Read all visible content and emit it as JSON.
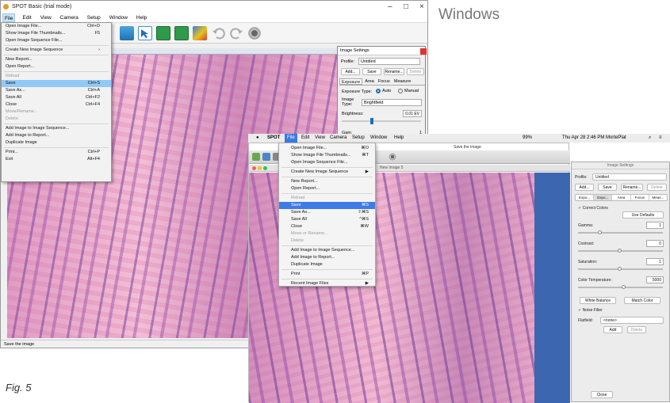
{
  "header": {
    "platform_label": "Windows",
    "figure_caption": "Fig. 5"
  },
  "windows_app": {
    "title": "SPOT Basic (trial mode)",
    "controls": [
      "–",
      "□",
      "×"
    ],
    "menubar": [
      "File",
      "Edit",
      "View",
      "Camera",
      "Setup",
      "Window",
      "Help"
    ],
    "file_menu": [
      {
        "label": "Open Image File...",
        "shortcut": "Ctrl+O"
      },
      {
        "label": "Show Image File Thumbnails...",
        "shortcut": "F5"
      },
      {
        "label": "Open Image Sequence File...",
        "shortcut": ""
      },
      {
        "sep": true
      },
      {
        "label": "Create New Image Sequence",
        "shortcut": "›"
      },
      {
        "sep": true
      },
      {
        "label": "New Report...",
        "shortcut": ""
      },
      {
        "label": "Open Report...",
        "shortcut": ""
      },
      {
        "sep": true
      },
      {
        "label": "Reload",
        "shortcut": "",
        "disabled": true
      },
      {
        "label": "Save",
        "shortcut": "Ctrl+S",
        "highlight": true
      },
      {
        "label": "Save As...",
        "shortcut": "Ctrl+A"
      },
      {
        "label": "Save All",
        "shortcut": "Ctrl+F2"
      },
      {
        "label": "Close",
        "shortcut": "Ctrl+F4"
      },
      {
        "label": "Move/Rename...",
        "shortcut": "",
        "disabled": true
      },
      {
        "label": "Delete",
        "shortcut": "",
        "disabled": true
      },
      {
        "sep": true
      },
      {
        "label": "Add Image to Image Sequence...",
        "shortcut": ""
      },
      {
        "label": "Add Image to Report...",
        "shortcut": ""
      },
      {
        "label": "Duplicate Image",
        "shortcut": ""
      },
      {
        "sep": true
      },
      {
        "label": "Print...",
        "shortcut": "Ctrl+P"
      },
      {
        "label": "Exit",
        "shortcut": "Alt+F4"
      }
    ],
    "settings_panel": {
      "title": "Image Settings",
      "profile_label": "Profile:",
      "profile_value": "Untitled",
      "buttons": [
        "Add...",
        "Save",
        "Rename...",
        "Delete"
      ],
      "tabs": [
        "Exposure",
        "Area",
        "Focus",
        "Measure"
      ],
      "exposure_type_label": "Exposure Type:",
      "auto_label": "Auto",
      "manual_label": "Manual",
      "image_type_label": "Image Type:",
      "image_type_value": "Brightfield",
      "brightness_label": "Brightness:",
      "brightness_value": "0.01 EV",
      "gain_label": "Gain:",
      "gain_value": "1"
    },
    "status": "Save the image"
  },
  "mac_app": {
    "menubar": [
      "SPOT",
      "File",
      "Edit",
      "View",
      "Camera",
      "Setup",
      "Window",
      "Help"
    ],
    "menubar_right": "Thu Apr 28  2:46 PM   MortePlat",
    "menubar_status": "99% ",
    "tooltip": "Save the image",
    "image_title": "New Image 5",
    "file_menu": [
      {
        "label": "Open Image File...",
        "shortcut": "⌘O"
      },
      {
        "label": "Show Image File Thumbnails...",
        "shortcut": "⌘T"
      },
      {
        "label": "Open Image Sequence File...",
        "shortcut": ""
      },
      {
        "sep": true
      },
      {
        "label": "Create New Image Sequence",
        "shortcut": "▶"
      },
      {
        "sep": true
      },
      {
        "label": "New Report...",
        "shortcut": ""
      },
      {
        "label": "Open Report...",
        "shortcut": ""
      },
      {
        "sep": true
      },
      {
        "label": "Reload",
        "shortcut": "",
        "disabled": true
      },
      {
        "label": "Save",
        "shortcut": "⌘S",
        "highlight": true
      },
      {
        "label": "Save As...",
        "shortcut": "⇧⌘S"
      },
      {
        "label": "Save All",
        "shortcut": "^⌘S"
      },
      {
        "label": "Close",
        "shortcut": "⌘W"
      },
      {
        "label": "Move or Rename...",
        "shortcut": "",
        "disabled": true
      },
      {
        "label": "Delete",
        "shortcut": "",
        "disabled": true
      },
      {
        "sep": true
      },
      {
        "label": "Add Image to Image Sequence...",
        "shortcut": ""
      },
      {
        "label": "Add Image to Report...",
        "shortcut": ""
      },
      {
        "label": "Duplicate Image",
        "shortcut": ""
      },
      {
        "sep": true
      },
      {
        "label": "Print",
        "shortcut": "⌘P"
      },
      {
        "sep": true
      },
      {
        "label": "Recent Image Files",
        "shortcut": "▶"
      }
    ],
    "settings_panel": {
      "title": "Image Settings",
      "profile_label": "Profile:",
      "profile_value": "Untitled",
      "buttons": [
        "Add...",
        "Save",
        "Rename...",
        "Delete"
      ],
      "tabs": [
        "Expo...",
        "Expo...",
        "Area",
        "Focus",
        "Meas..."
      ],
      "correct_colors": "Correct Colors",
      "use_defaults": "Use Defaults",
      "gamma_label": "Gamma:",
      "gamma_value": "1",
      "contrast_label": "Contrast:",
      "contrast_value": "0",
      "saturation_label": "Saturation:",
      "saturation_value": "1",
      "color_temp_label": "Color Temperature:",
      "color_temp_value": "5000",
      "white_balance": "White Balance",
      "match_color": "Match Color",
      "noise_filter": "Noise Filter",
      "flatfield_label": "Flatfield:",
      "flatfield_value": "<none>",
      "add": "Add",
      "delete": "Delete",
      "close": "Close"
    }
  }
}
